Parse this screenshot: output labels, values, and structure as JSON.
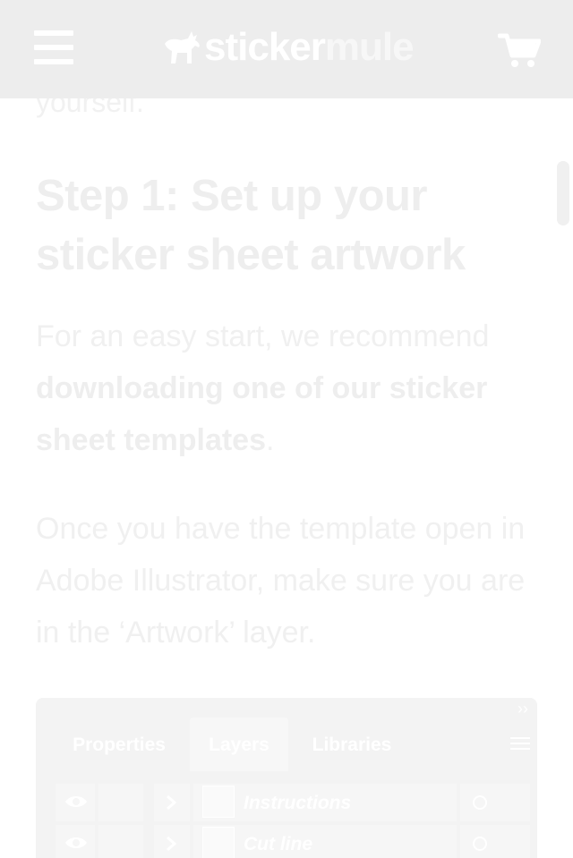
{
  "header": {
    "logo": {
      "word_part1": "sticker",
      "word_part2": "mule"
    },
    "icons": {
      "menu": "hamburger-icon",
      "cart": "shopping-cart-icon",
      "mascot": "mule-icon"
    }
  },
  "article": {
    "intro_tail": "yourself.",
    "step_heading": "Step 1: Set up your sticker sheet artwork",
    "para1_text": "For an easy start, we recommend ",
    "para1_bold": "downloading one of our sticker sheet templates",
    "para1_end": ".",
    "para2": "Once you have the template open in Adobe Illustrator, make sure you are in the ‘Artwork’ layer."
  },
  "panel": {
    "collapse": "››",
    "tabs": [
      {
        "label": "Properties",
        "active": false
      },
      {
        "label": "Layers",
        "active": true
      },
      {
        "label": "Libraries",
        "active": false
      }
    ],
    "layers": [
      {
        "name": "Instructions"
      },
      {
        "name": "Cut line"
      }
    ]
  },
  "colors": {
    "header_bg": "#ededed",
    "text_faded": "#f0f0f0",
    "panel_bg": "#f3f3f3"
  }
}
